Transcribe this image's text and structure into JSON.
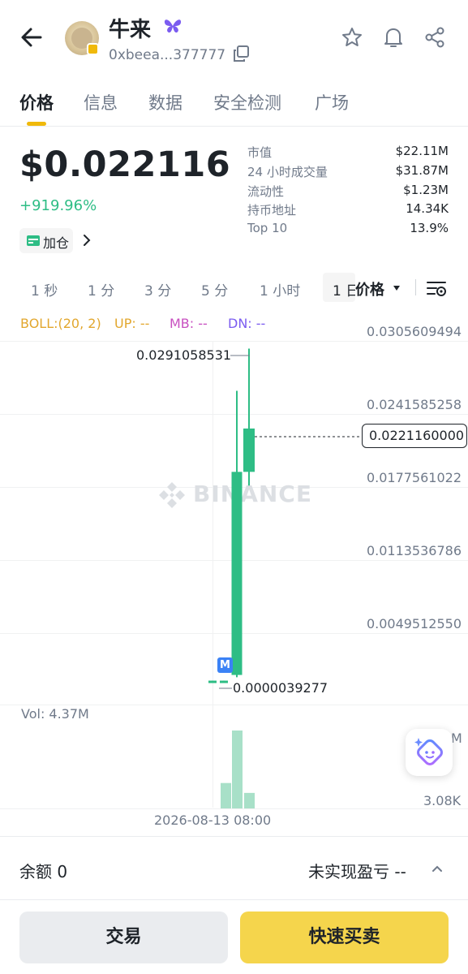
{
  "header": {
    "token_name": "牛来",
    "address": "0xbeea...377777",
    "icons": [
      "back-icon",
      "butterfly-icon",
      "copy-icon",
      "star-icon",
      "bell-icon",
      "share-icon"
    ]
  },
  "tabs": [
    {
      "label": "价格",
      "active": true
    },
    {
      "label": "信息",
      "active": false
    },
    {
      "label": "数据",
      "active": false
    },
    {
      "label": "安全检测",
      "active": false
    },
    {
      "label": "广场",
      "active": false
    }
  ],
  "price": {
    "current": "$0.022116",
    "change": "+919.96%",
    "position_label": "加仓"
  },
  "stats": [
    {
      "label": "市值",
      "value": "$22.11M"
    },
    {
      "label": "24 小时成交量",
      "value": "$31.87M"
    },
    {
      "label": "流动性",
      "value": "$1.23M"
    },
    {
      "label": "持币地址",
      "value": "14.34K"
    },
    {
      "label": "Top 10",
      "value": "13.9%"
    }
  ],
  "intervals": [
    "1 秒",
    "1 分",
    "3 分",
    "5 分",
    "1 小时",
    "1 日"
  ],
  "chart_controls": {
    "price_dropdown": "价格"
  },
  "boll": {
    "label": "BOLL:(20, 2)",
    "up": "UP: --",
    "mb": "MB: --",
    "dn": "DN: --"
  },
  "chart_data": {
    "type": "candlestick",
    "watermark": "BINANCE",
    "y_ticks": [
      "0.0305609494",
      "0.0241585258",
      "0.0177561022",
      "0.0113536786",
      "0.0049512550"
    ],
    "current_price_label": "0.0221160000",
    "high_label": "0.0291058531",
    "low_label": "0.0000039277",
    "marker": "M",
    "x_label": "2026-08-13 08:00",
    "candles": [
      {
        "open": 3.9e-06,
        "close": 3.9e-06,
        "high": 3.9e-06,
        "low": 3.9e-06
      },
      {
        "open": 3.9e-06,
        "close": 3.9e-06,
        "high": 5e-06,
        "low": 3.9e-06
      },
      {
        "open": 0.0005,
        "close": 0.0183,
        "high": 0.0254,
        "low": 0.0003
      },
      {
        "open": 0.0183,
        "close": 0.0221,
        "high": 0.0291,
        "low": 0.0171
      }
    ],
    "volume": {
      "label": "Vol: 4.37M",
      "max_label": "M",
      "min_label": "3.08K",
      "bars": [
        0.9,
        2.76,
        0.55
      ]
    }
  },
  "bottom": {
    "balance": "余额 0",
    "pnl": "未实现盈亏 --",
    "trade_button": "交易",
    "quick_button": "快速买卖"
  },
  "colors": {
    "up": "#2ebd85",
    "accent": "#f0b90b",
    "quick_button": "#f5d54c"
  }
}
